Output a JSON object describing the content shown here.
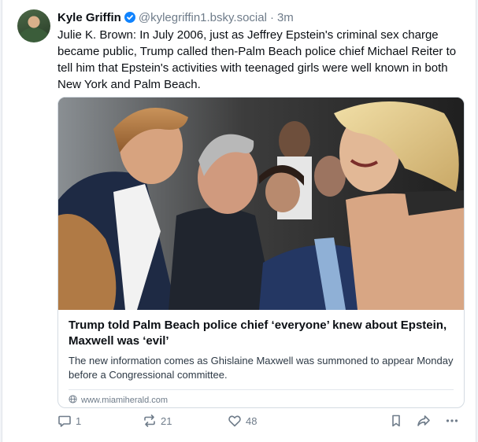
{
  "post": {
    "author_name": "Kyle Griffin",
    "author_handle": "@kylegriffin1.bsky.social",
    "separator": "·",
    "timestamp": "3m",
    "text": "Julie K. Brown: In July 2006, just as Jeffrey Epstein's criminal sex charge became public, Trump called then-Palm Beach police chief Michael Reiter to tell him that Epstein's activities with teenaged girls were well known in both New York and Palm Beach."
  },
  "link_card": {
    "title": "Trump told Palm Beach police chief ‘everyone’ knew about Epstein, Maxwell was ‘evil’",
    "description": "The new information comes as Ghislaine Maxwell was summoned to appear Monday before a Congressional committee.",
    "domain": "www.miamiherald.com"
  },
  "actions": {
    "reply_count": "1",
    "repost_count": "21",
    "like_count": "48"
  },
  "colors": {
    "verified_badge": "#1083fe",
    "muted_text": "#6f7c8a",
    "border": "#d4dbe2"
  },
  "icons": [
    "verified-icon",
    "globe-icon",
    "reply-icon",
    "repost-icon",
    "like-icon",
    "bookmark-icon",
    "share-icon",
    "more-icon"
  ]
}
